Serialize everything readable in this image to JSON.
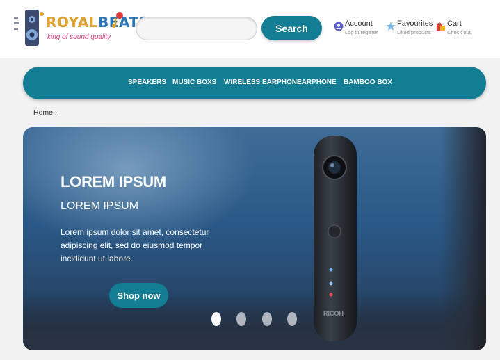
{
  "logo": {
    "title_part1": "ROYAL",
    "title_part2": "BEATS",
    "tagline": "king of sound quality",
    "icon": "speaker-logo-icon",
    "colors": {
      "royal": "#e0a22b",
      "beats": "#2a76b8",
      "tagline": "#d63a7a"
    }
  },
  "search": {
    "placeholder": "",
    "value": "",
    "button_label": "Search"
  },
  "header_links": [
    {
      "title": "Account",
      "subtitle": "Log in/register",
      "icon": "account-icon"
    },
    {
      "title": "Favourites",
      "subtitle": "Liked products",
      "icon": "star-icon"
    },
    {
      "title": "Cart",
      "subtitle": "Check out",
      "icon": "cart-icon"
    }
  ],
  "nav": {
    "items": [
      "SPEAKERS",
      "MUSIC BOXS",
      "WIRELESS EARPHONE",
      "EARPHONE",
      "BAMBOO BOX"
    ]
  },
  "breadcrumb": {
    "home": "Home",
    "separator": "›"
  },
  "hero": {
    "heading": "LOREM IPSUM",
    "subheading": "LOREM IPSUM",
    "text": "Lorem ipsum dolor sit amet, consectetur adipiscing elit, sed do eiusmod tempor incididunt ut labore.",
    "button_label": "Shop now",
    "product_brand": "RICOH",
    "slide_count": 4,
    "active_slide": 1
  },
  "colors": {
    "accent": "#137d94",
    "header_bg": "#ffffff",
    "page_bg": "#f2f2f2"
  }
}
